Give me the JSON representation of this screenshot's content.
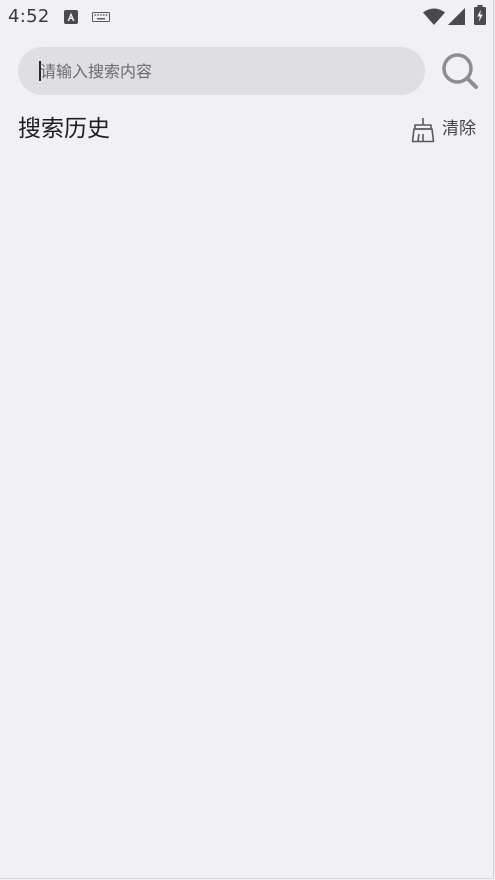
{
  "status_bar": {
    "time": "4:52",
    "icons": [
      "app-notification-icon",
      "keyboard-icon",
      "wifi-icon",
      "signal-icon",
      "battery-charging-icon"
    ]
  },
  "search": {
    "placeholder": "请输入搜索内容",
    "value": "",
    "button_icon": "search-icon"
  },
  "history": {
    "title": "搜索历史",
    "clear_label": "清除",
    "clear_icon": "broom-icon",
    "items": []
  },
  "colors": {
    "background": "#f1f0f5",
    "search_box": "#dfdfe3",
    "icon_gray": "#8e8e8e",
    "text_dark": "#1e1e1e"
  }
}
